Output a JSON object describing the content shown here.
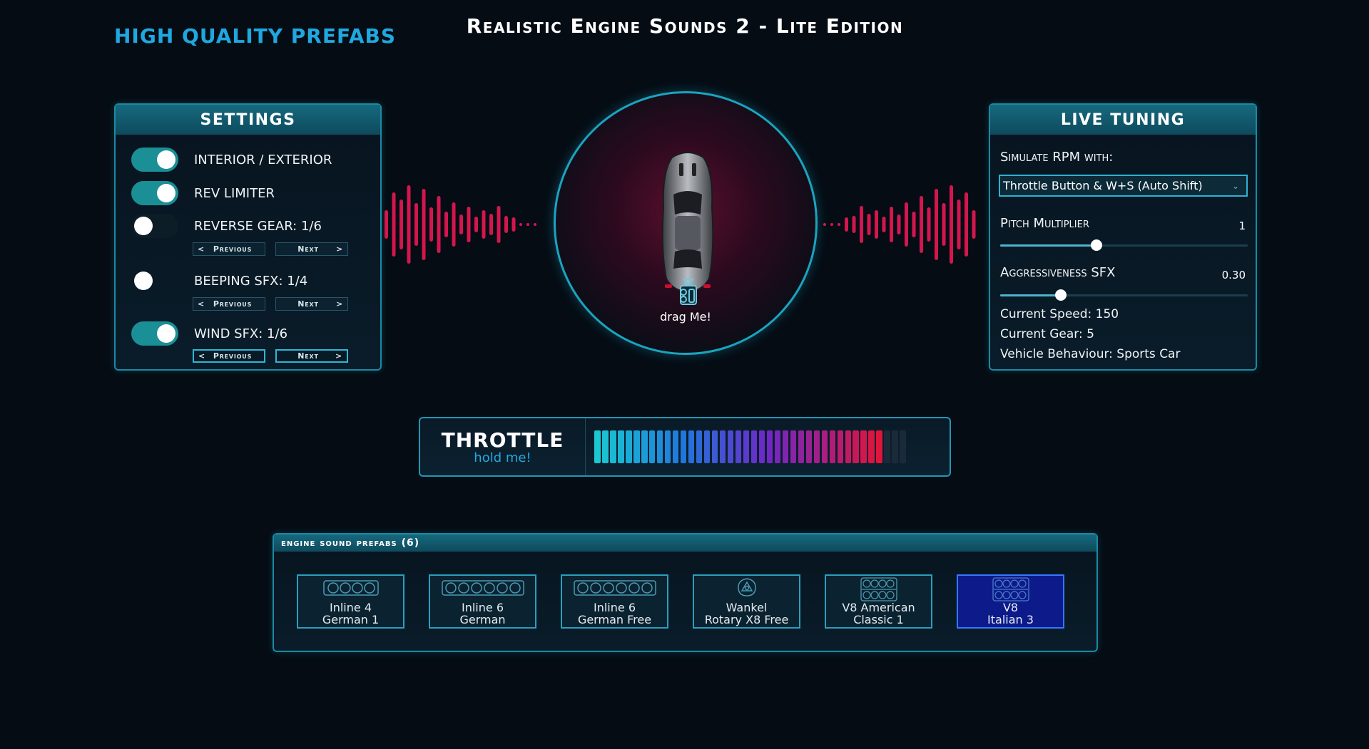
{
  "brand": "HIGH QUALITY PREFABS",
  "title": "Realistic Engine Sounds 2 - Lite Edition",
  "settings": {
    "header": "SETTINGS",
    "rows": [
      {
        "label": "INTERIOR / EXTERIOR",
        "on": true
      },
      {
        "label": "REV LIMITER",
        "on": true
      },
      {
        "label": "REVERSE GEAR: 1/6",
        "on": false
      },
      {
        "label": "BEEPING SFX: 1/4",
        "on": false
      },
      {
        "label": "WIND SFX: 1/6",
        "on": true
      }
    ],
    "prev_label": "Previous",
    "next_label": "Next",
    "prev_arrow": "<",
    "next_arrow": ">"
  },
  "car": {
    "drag_label": "drag Me!"
  },
  "live": {
    "header": "LIVE TUNING",
    "simulate_label": "Simulate RPM with:",
    "simulate_value": "Throttle Button & W+S (Auto Shift)",
    "pitch_label": "Pitch Multiplier",
    "pitch_value": "1",
    "pitch_fraction": 0.39,
    "aggr_label": "Aggressiveness SFX",
    "aggr_value": "0.30",
    "aggr_fraction": 0.245,
    "speed": "Current Speed: 150",
    "gear": "Current Gear: 5",
    "behaviour": "Vehicle Behaviour: Sports Car"
  },
  "throttle": {
    "title": "THROTTLE",
    "subtitle": "hold me!",
    "level": 0.92
  },
  "prefabs": {
    "header": "engine sound prefabs",
    "count": "(6)",
    "items": [
      {
        "line1": "Inline 4",
        "line2": "German 1",
        "icon": "inline-4-engine-icon",
        "selected": false
      },
      {
        "line1": "Inline 6",
        "line2": "German",
        "icon": "inline-6-engine-icon",
        "selected": false
      },
      {
        "line1": "Inline 6",
        "line2": "German Free",
        "icon": "inline-6-engine-icon",
        "selected": false
      },
      {
        "line1": "Wankel",
        "line2": "Rotary X8 Free",
        "icon": "rotary-engine-icon",
        "selected": false
      },
      {
        "line1": "V8 American",
        "line2": "Classic 1",
        "icon": "v8-engine-icon",
        "selected": false
      },
      {
        "line1": "V8",
        "line2": "Italian 3",
        "icon": "v8-engine-icon",
        "selected": true
      }
    ]
  },
  "colors": {
    "accent": "#1fa8e0",
    "toggle_on": "#1a8f96",
    "wave": "#d3164e",
    "selected_prefab": "#0d1a8a"
  }
}
